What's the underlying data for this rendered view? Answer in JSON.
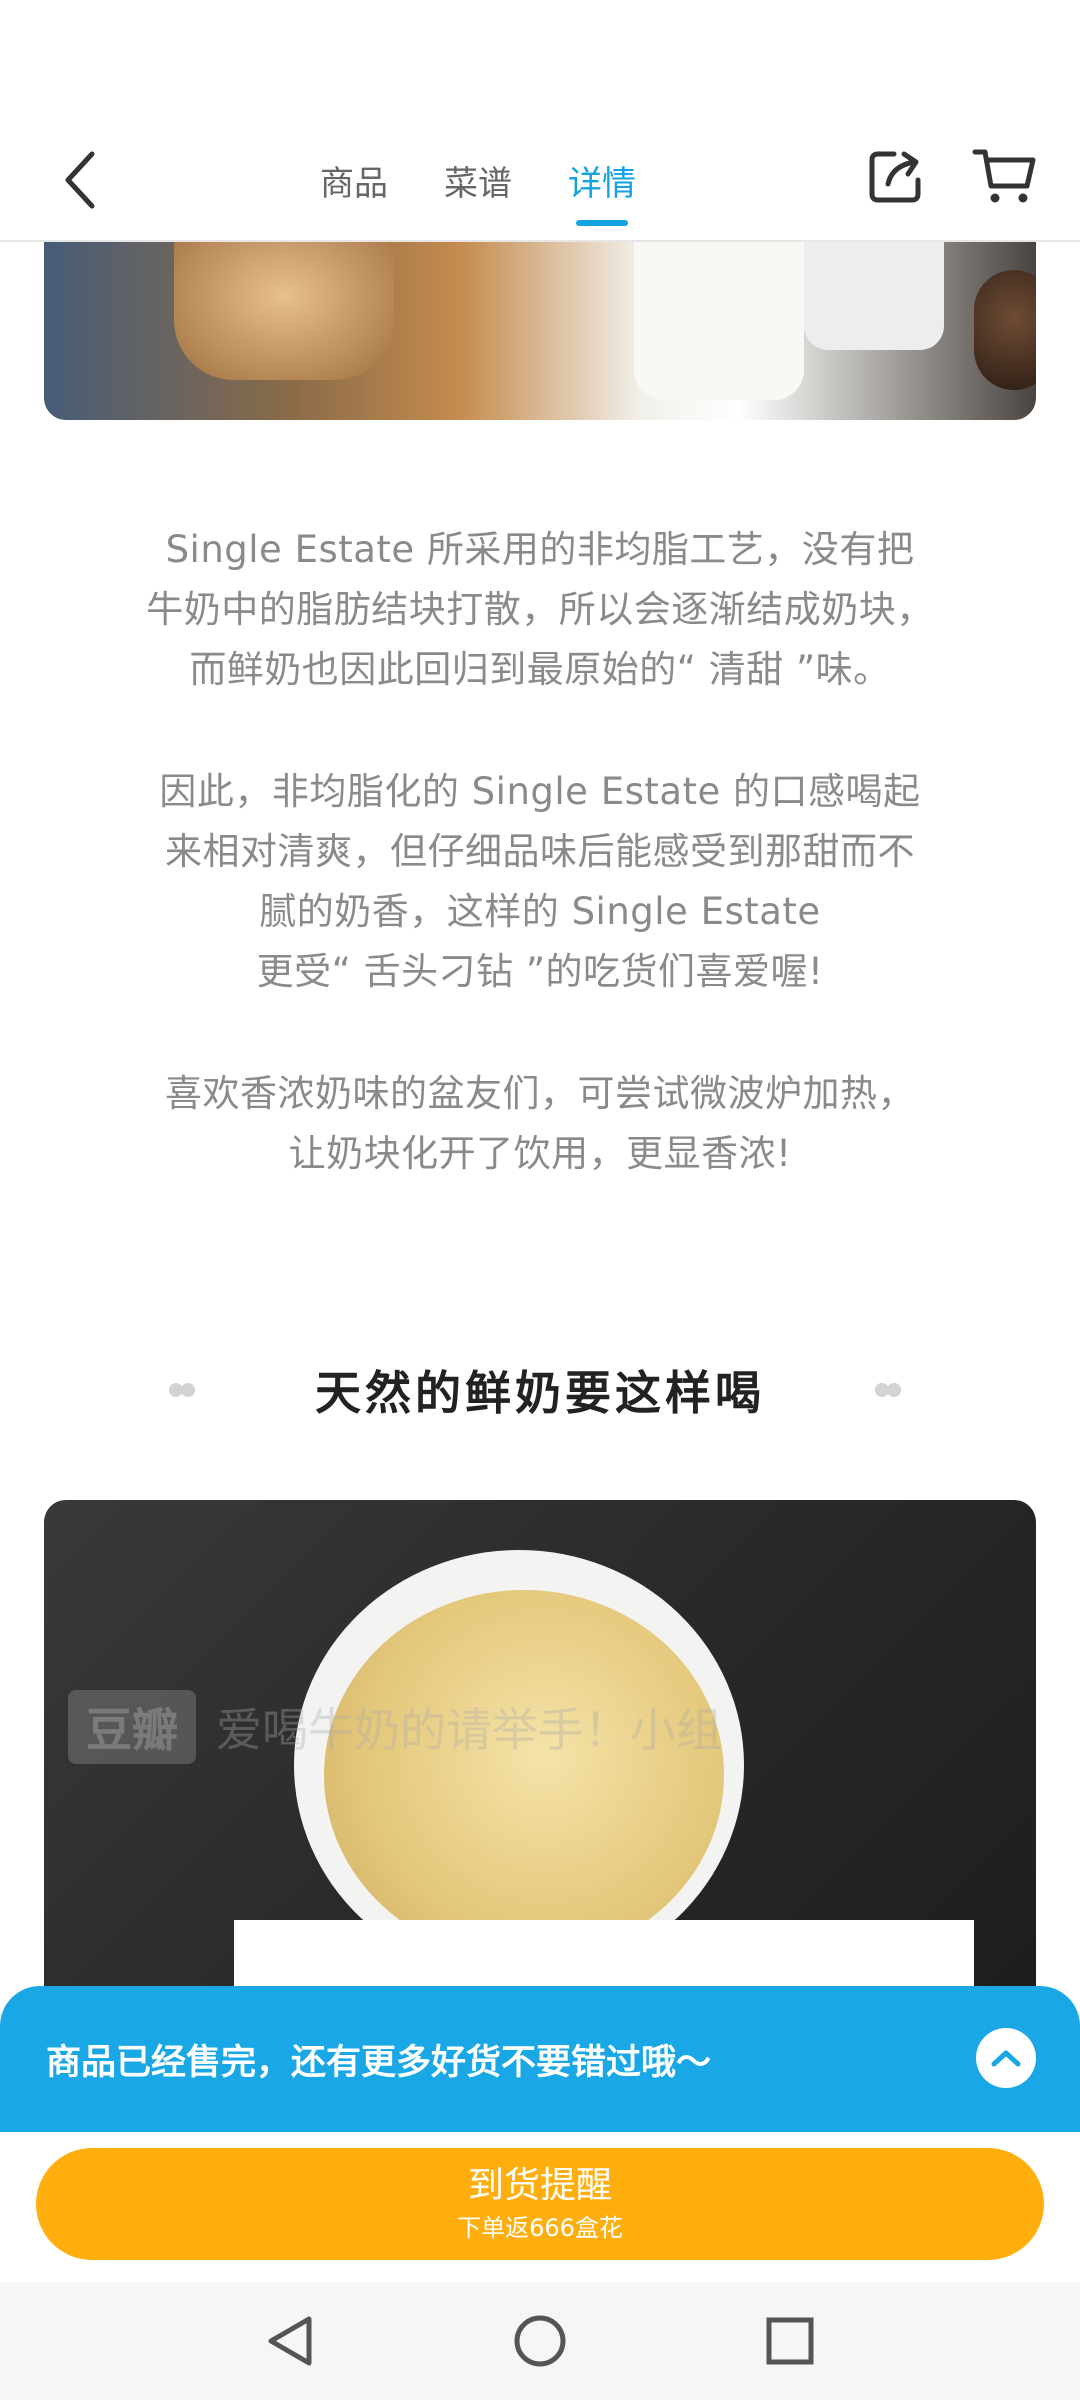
{
  "header": {
    "tabs": [
      {
        "label": "商品"
      },
      {
        "label": "菜谱"
      },
      {
        "label": "详情"
      }
    ],
    "active_tab": "详情",
    "back_icon": "chevron-left-icon",
    "share_icon": "share-icon",
    "cart_icon": "cart-icon",
    "accent_color": "#13a3e0"
  },
  "content": {
    "paragraph1": [
      "Single Estate 所采用的非均脂工艺，没有把",
      "牛奶中的脂肪结块打散，所以会逐渐结成奶块，",
      "而鲜奶也因此回归到最原始的“ 清甜 ”味。"
    ],
    "paragraph2": [
      "因此，非均脂化的 Single Estate 的口感喝起",
      "来相对清爽，但仔细品味后能感受到那甜而不",
      "腻的奶香，这样的 Single Estate",
      "更受“ 舌头刁钻 ”的吃货们喜爱喔!"
    ],
    "paragraph3": [
      "喜欢香浓奶味的盆友们，可尝试微波炉加热，",
      "让奶块化开了饮用，更显香浓!"
    ],
    "section_title": "天然的鲜奶要这样喝",
    "watermark_badge": "豆瓣",
    "watermark_text": "爱喝牛奶的请举手！小组"
  },
  "soldout": {
    "message": "商品已经售完，还有更多好货不要错过哦～",
    "collapse_icon": "chevron-up-icon",
    "color": "#1aa7e6"
  },
  "bottom": {
    "button_label": "到货提醒",
    "button_sub": "下单返666盒花",
    "button_color": "#ffae0d"
  },
  "system_nav": {
    "back": "triangle-back-icon",
    "home": "circle-home-icon",
    "recents": "square-recents-icon"
  }
}
